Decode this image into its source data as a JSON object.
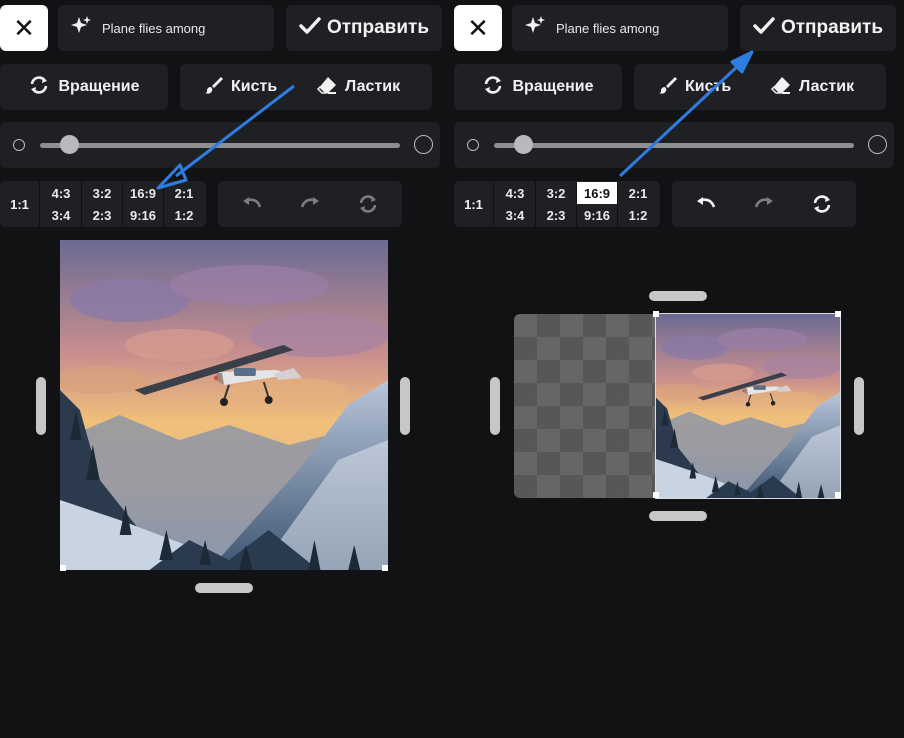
{
  "left_panel": {
    "close_label": "✕",
    "prompt_text": "Plane flies among",
    "send_label": "Отправить",
    "rotate_label": "Вращение",
    "brush_label": "Кисть",
    "eraser_label": "Ластик",
    "ratio_square": "1:1",
    "ratios_top": [
      "4:3",
      "3:2",
      "16:9",
      "2:1"
    ],
    "ratios_bottom": [
      "3:4",
      "2:3",
      "9:16",
      "1:2"
    ],
    "selected_ratio": "none"
  },
  "right_panel": {
    "close_label": "✕",
    "prompt_text": "Plane flies among",
    "send_label": "Отправить",
    "rotate_label": "Вращение",
    "brush_label": "Кисть",
    "eraser_label": "Ластик",
    "ratio_square": "1:1",
    "ratios_top": [
      "4:3",
      "3:2",
      "16:9",
      "2:1"
    ],
    "ratios_bottom": [
      "3:4",
      "2:3",
      "9:16",
      "1:2"
    ],
    "selected_ratio": "16:9"
  },
  "colors": {
    "background": "#111214",
    "control_bg": "#1e2024",
    "annotation_arrow": "#2f7de1",
    "selected_ratio_bg": "#ffffff"
  },
  "icons": [
    "close-icon",
    "sparkle-icon",
    "check-icon",
    "rotate-icon",
    "brush-icon",
    "eraser-icon",
    "undo-icon",
    "redo-icon",
    "reset-icon"
  ]
}
